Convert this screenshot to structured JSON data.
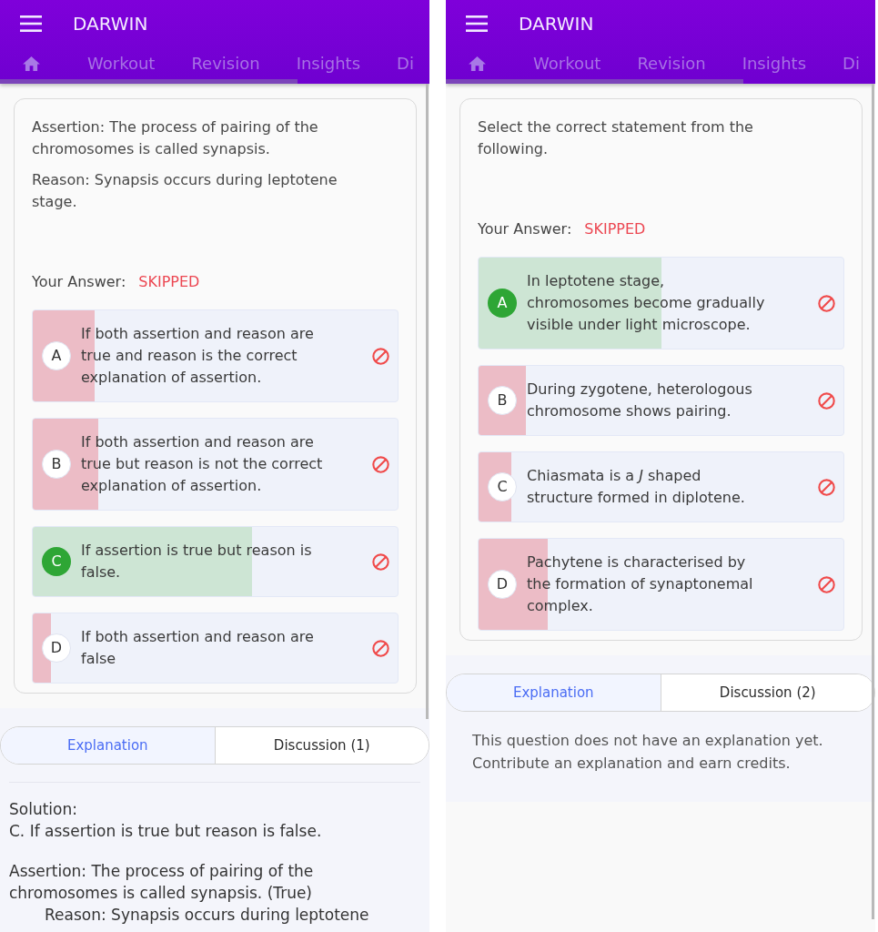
{
  "screens": [
    {
      "app_bar": {
        "title": "DARWIN",
        "tabs": [
          "Workout",
          "Revision",
          "Insights",
          "Di"
        ]
      },
      "question": {
        "paragraphs": [
          "Assertion: The process of pairing of the chromosomes is called synapsis.",
          "Reason: Synapsis occurs during leptotene stage."
        ],
        "answer_label": "Your Answer:",
        "answer_status": "SKIPPED",
        "options": [
          {
            "letter": "A",
            "text": "If both assertion and reason are true and reason is the correct explanation of assertion.",
            "correct": false,
            "level": 0.17
          },
          {
            "letter": "B",
            "text": "If both assertion and reason are true but reason is not the correct explanation of assertion.",
            "correct": false,
            "level": 0.18
          },
          {
            "letter": "C",
            "text": "If assertion is true but reason is false.",
            "correct": true,
            "level": 0.6
          },
          {
            "letter": "D",
            "text": "If both assertion and reason are false",
            "correct": false,
            "level": 0.05
          }
        ]
      },
      "explanation_tabs": [
        {
          "label": "Explanation",
          "selected": true
        },
        {
          "label": "Discussion (1)",
          "selected": false
        }
      ],
      "explanation": {
        "kind": "solution",
        "paragraphs": [
          {
            "lines": [
              {
                "text": "Solution:",
                "indented": false
              },
              {
                "text": "C. If assertion is true but reason is false.",
                "indented": false
              }
            ]
          },
          {
            "lines": [
              {
                "text": "Assertion: The process of pairing of the chromosomes is called synapsis. (True)",
                "indented": false
              },
              {
                "text": "Reason: Synapsis occurs during leptotene",
                "indented": true
              }
            ]
          }
        ]
      }
    },
    {
      "app_bar": {
        "title": "DARWIN",
        "tabs": [
          "Workout",
          "Revision",
          "Insights",
          "Di"
        ]
      },
      "question": {
        "paragraphs": [
          "Select the correct statement from the following."
        ],
        "answer_label": "Your Answer:",
        "answer_status": "SKIPPED",
        "options": [
          {
            "letter": "A",
            "text": "In leptotene stage, chromosomes become gradually visible under light microscope.",
            "correct": true,
            "level": 0.5
          },
          {
            "letter": "B",
            "text": "During zygotene, heterologous chromosome shows pairing.",
            "correct": false,
            "level": 0.13
          },
          {
            "letter": "C",
            "text": "Chiasmata is a *J* shaped structure formed in diplotene.",
            "correct": false,
            "level": 0.09
          },
          {
            "letter": "D",
            "text": "Pachytene is characterised by the formation of synaptonemal complex.",
            "correct": false,
            "level": 0.19
          }
        ]
      },
      "explanation_tabs": [
        {
          "label": "Explanation",
          "selected": true
        },
        {
          "label": "Discussion (2)",
          "selected": false
        }
      ],
      "explanation": {
        "kind": "empty",
        "paragraphs": [
          {
            "lines": [
              {
                "text": "This question does not have an explanation yet. Contribute an explanation and earn credits.",
                "indented": false
              }
            ]
          }
        ]
      }
    }
  ]
}
